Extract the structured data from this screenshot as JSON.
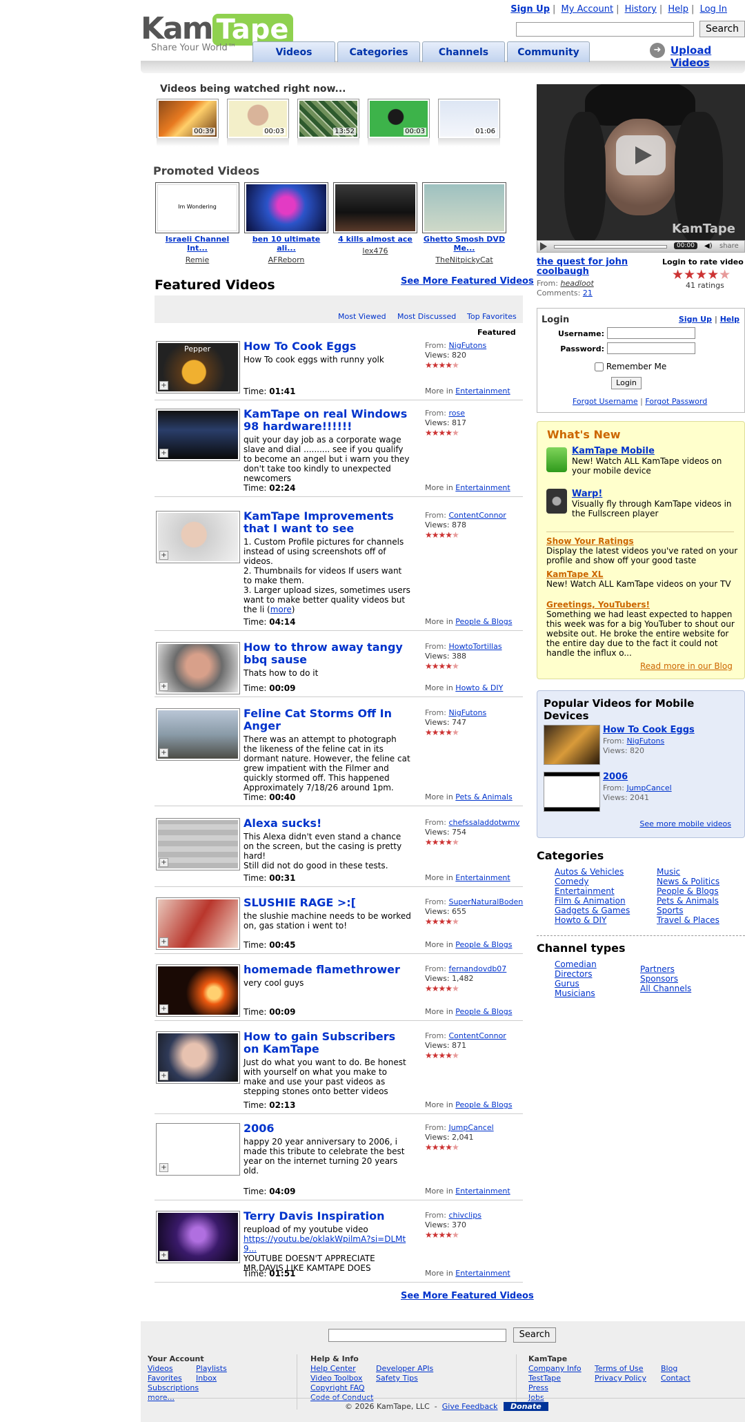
{
  "header": {
    "logo_kam": "Kam",
    "logo_tape": "Tape",
    "tagline": "Share Your World™",
    "links": [
      "Sign Up",
      "My Account",
      "History",
      "Help",
      "Log In"
    ],
    "search_button": "Search",
    "tabs": [
      "Videos",
      "Categories",
      "Channels",
      "Community"
    ],
    "upload": "Upload Videos"
  },
  "watching": {
    "title": "Videos being watched right now...",
    "items": [
      {
        "duration": "00:39"
      },
      {
        "duration": "00:03"
      },
      {
        "duration": "13:52"
      },
      {
        "duration": "00:03"
      },
      {
        "duration": "01:06"
      }
    ]
  },
  "promoted": {
    "title": "Promoted Videos",
    "items": [
      {
        "title": "Israeli Channel Int...",
        "author": "Remie",
        "thumb_text": "Im Wondering"
      },
      {
        "title": "ben 10 ultimate ali...",
        "author": "AFReborn"
      },
      {
        "title": "4 kills almost ace",
        "author": "lex476"
      },
      {
        "title": "Ghetto Smosh DVD Me...",
        "author": "TheNitpickyCat"
      }
    ]
  },
  "featured": {
    "title": "Featured Videos",
    "see_more": "See More Featured Videos",
    "nav": [
      "Most Viewed",
      "Most Discussed",
      "Top Favorites",
      "Featured"
    ],
    "from_label": "From:",
    "views_label": "Views:",
    "time_label": "Time:",
    "more_in_label": "More in",
    "items": [
      {
        "title": "How To Cook Eggs",
        "desc": "How To cook eggs with runny yolk",
        "time": "01:41",
        "from": "NigFutons",
        "views": "820",
        "category": "Entertainment",
        "thumb_text": "Pepper"
      },
      {
        "title": "KamTape on real Windows 98 hardware!!!!!!",
        "desc": "quit your day job as a corporate wage slave and dial .......... see if you qualify to become an angel but i warn you they don't take too kindly to unexpected newcomers",
        "time": "02:24",
        "from": "rose",
        "views": "817",
        "category": "Entertainment"
      },
      {
        "title": "KamTape Improvements that I want to see",
        "desc": "1. Custom Profile pictures for channels instead of using screenshots off of videos.\n2. Thumbnails for videos If users want to make them.\n3. Larger upload sizes, sometimes users want to make better quality videos but the li",
        "more": "more",
        "time": "04:14",
        "from": "ContentConnor",
        "views": "878",
        "category": "People & Blogs"
      },
      {
        "title": "How to throw away tangy bbq sause",
        "desc": "Thats how to do it",
        "time": "00:09",
        "from": "HowtoTortillas",
        "views": "388",
        "category": "Howto & DIY"
      },
      {
        "title": "Feline Cat Storms Off In Anger",
        "desc": "There was an attempt to photograph the likeness of the feline cat in its dormant nature. However, the feline cat grew impatient with the Filmer and quickly stormed off. This happened Approximately 7/18/26 around 1pm.",
        "time": "00:40",
        "from": "NigFutons",
        "views": "747",
        "category": "Pets & Animals"
      },
      {
        "title": "Alexa sucks!",
        "desc": "This Alexa didn't even stand a chance on the screen, but the casing is pretty hard!\nStill did not do good in these tests.",
        "time": "00:31",
        "from": "chefssaladdotwmv",
        "views": "754",
        "category": "Entertainment"
      },
      {
        "title": "SLUSHIE RAGE >:[",
        "desc": "the slushie machine needs to be worked on, gas station i went to!",
        "time": "00:45",
        "from": "SuperNaturalBoden",
        "views": "655",
        "category": "People & Blogs"
      },
      {
        "title": "homemade flamethrower",
        "desc": "very cool guys",
        "time": "00:09",
        "from": "fernandovdb07",
        "views": "1,482",
        "category": "People & Blogs"
      },
      {
        "title": "How to gain Subscribers on KamTape",
        "desc": "Just do what you want to do. Be honest with yourself on what you make to make and use your past videos as stepping stones onto better videos",
        "time": "02:13",
        "from": "ContentConnor",
        "views": "871",
        "category": "People & Blogs"
      },
      {
        "title": "2006",
        "desc": "happy 20 year anniversary to 2006, i made this tribute to celebrate the best year on the internet turning 20 years old.",
        "time": "04:09",
        "from": "JumpCancel",
        "views": "2,041",
        "category": "Entertainment"
      },
      {
        "title": "Terry Davis Inspiration",
        "desc_pre": "reupload of my youtube video",
        "desc_link": "https://youtu.be/oklakWpilmA?si=DLMt9...",
        "desc_post": "YOUTUBE DOESN'T APPRECIATE MR.DAVIS LIKE KAMTAPE DOES",
        "time": "01:51",
        "from": "chivclips",
        "views": "370",
        "category": "Entertainment"
      }
    ]
  },
  "player": {
    "time": "00:00",
    "share": "share",
    "watermark": "KamTape",
    "title": "the quest for john coolbaugh",
    "from_label": "From:",
    "from": "headloot",
    "comments_label": "Comments:",
    "comments": "21",
    "rate_label": "Login to rate video",
    "rating": 4.5,
    "rating_count": "41 ratings"
  },
  "login": {
    "title": "Login",
    "signup": "Sign Up",
    "help": "Help",
    "username_label": "Username:",
    "password_label": "Password:",
    "remember": "Remember Me",
    "button": "Login",
    "forgot_username": "Forgot Username",
    "forgot_password": "Forgot Password"
  },
  "whats_new": {
    "title": "What's New",
    "mobile_head": "KamTape Mobile",
    "mobile_text": "New! Watch ALL KamTape videos on your mobile device",
    "warp_head": "Warp!",
    "warp_text": "Visually fly through KamTape videos in the Fullscreen player",
    "ratings_head": "Show Your Ratings",
    "ratings_text": "Display the latest videos you've rated on your profile and show off your good taste",
    "xl_head": "KamTape XL",
    "xl_text": "New! Watch ALL KamTape videos on your TV",
    "greet_head": "Greetings, YouTubers!",
    "greet_text": "Something we had least expected to happen this week was for a big YouTuber to shout our website out. He broke the entire website for the entire day due to the fact it could not handle the influx o...",
    "blog_link": "Read more in our Blog"
  },
  "mobile_popular": {
    "title": "Popular Videos for Mobile Devices",
    "items": [
      {
        "title": "How To Cook Eggs",
        "from": "NigFutons",
        "views": "820"
      },
      {
        "title": "2006",
        "from": "JumpCancel",
        "views": "2041"
      }
    ],
    "from_label": "From:",
    "views_label": "Views:",
    "more": "See more mobile videos"
  },
  "categories": {
    "title": "Categories",
    "col1": [
      "Autos & Vehicles",
      "Comedy",
      "Entertainment",
      "Film & Animation",
      "Gadgets & Games",
      "Howto & DIY"
    ],
    "col2": [
      "Music",
      "News & Politics",
      "People & Blogs",
      "Pets & Animals",
      "Sports",
      "Travel & Places"
    ]
  },
  "channel_types": {
    "title": "Channel types",
    "col1": [
      "Comedian",
      "Directors",
      "Gurus",
      "Musicians"
    ],
    "col2": [
      "Partners",
      "Sponsors",
      "All Channels"
    ]
  },
  "footer": {
    "search_button": "Search",
    "account_title": "Your Account",
    "account_col1": [
      "Videos",
      "Favorites",
      "Subscriptions",
      "more..."
    ],
    "account_col2": [
      "Playlists",
      "Inbox"
    ],
    "help_title": "Help & Info",
    "help_col1": [
      "Help Center",
      "Video Toolbox",
      "Copyright FAQ",
      "Code of Conduct"
    ],
    "help_col2": [
      "Developer APIs",
      "Safety Tips"
    ],
    "kamtape_title": "KamTape",
    "kt_col1": [
      "Company Info",
      "TestTape",
      "Press",
      "Jobs"
    ],
    "kt_col2": [
      "Terms of Use",
      "Privacy Policy"
    ],
    "kt_col3": [
      "Blog",
      "Contact"
    ],
    "copyright": "© 2026 KamTape, LLC",
    "feedback": "Give Feedback",
    "donate": "Donate"
  },
  "colors": {
    "link": "#0033cc",
    "star": "#cc3333",
    "orange": "#cc6600",
    "logo_green": "#8fd14f"
  }
}
